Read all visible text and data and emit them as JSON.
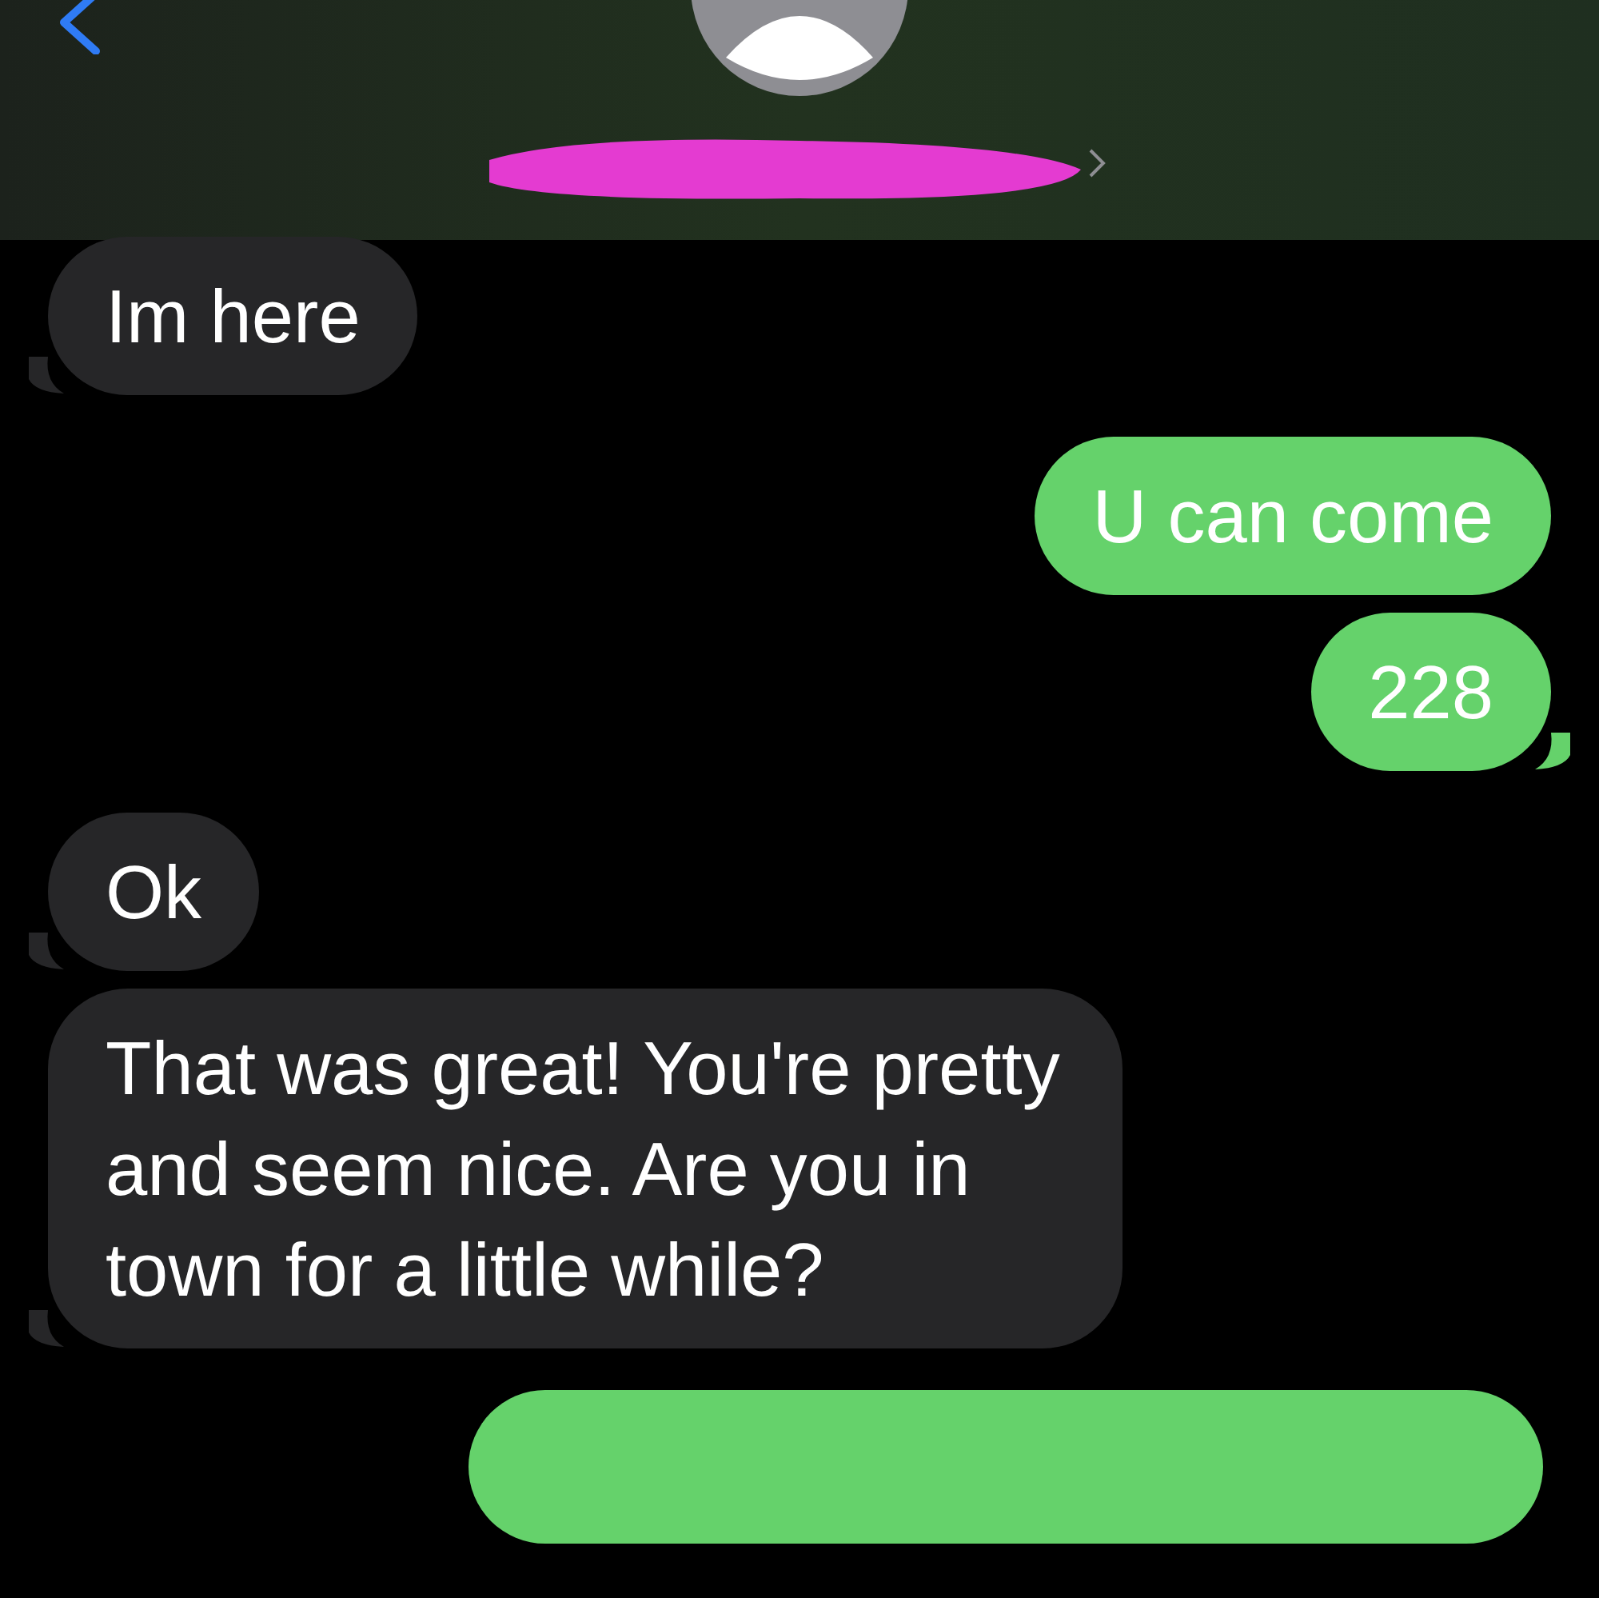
{
  "header": {
    "name_redacted": true
  },
  "messages": [
    {
      "kind": "received",
      "text": "Im here",
      "tail": true
    },
    {
      "kind": "sent",
      "text": "U can come",
      "tail": false
    },
    {
      "kind": "sent",
      "text": "228",
      "tail": true
    },
    {
      "kind": "received",
      "text": "Ok",
      "tail": true
    },
    {
      "kind": "received",
      "text": "That was great! You're pretty and seem nice. Are you in town for a little while?",
      "tail": true
    },
    {
      "kind": "sent",
      "tail": false
    }
  ]
}
